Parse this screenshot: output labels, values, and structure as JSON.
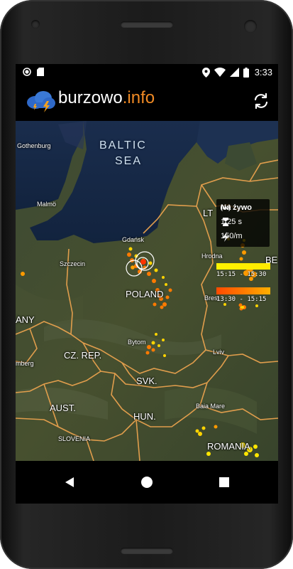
{
  "status_bar": {
    "time": "3:33",
    "left_icons": [
      "record-icon",
      "sd-card-icon"
    ],
    "right_icons": [
      "location-icon",
      "wifi-icon",
      "signal-icon",
      "battery-icon"
    ]
  },
  "app_bar": {
    "brand_name": "burzowo",
    "brand_tld": ".info",
    "logo": "storm-cloud-icon",
    "action_icon": "refresh-icon"
  },
  "info_panel": {
    "mode_label": "Na żywo",
    "interval_label": "1.25 s",
    "rate_label": "150/m"
  },
  "legend": {
    "recent_range": "15:15 - 15:30",
    "older_range": "13:30 - 15:15",
    "recent_color": "#fff200",
    "older_color": "#ff6a00"
  },
  "map": {
    "sea_line1": "BALTIC",
    "sea_line2": "SEA",
    "labels": {
      "gothenburg": "Gothenburg",
      "malmo": "Malmö",
      "gdansk": "Gdańsk",
      "szczecin": "Szczecin",
      "poland": "POLAND",
      "hrodna": "Hrodna",
      "brest": "Brest",
      "bytom": "Bytom",
      "czrep": "CZ. REP.",
      "svk": "SVK.",
      "lviv": "Lviv",
      "aust": "AUST.",
      "hun": "HUN.",
      "slovenia": "SLOVENIA",
      "baia_mare": "Baia Mare",
      "romania": "ROMANIA",
      "lt": "LT",
      "be": "BE",
      "any": "ANY",
      "berg": "mberg"
    }
  },
  "fab_icon": "chevron-up-icon",
  "nav": {
    "back": "back-icon",
    "home": "home-icon",
    "recents": "recents-icon"
  }
}
